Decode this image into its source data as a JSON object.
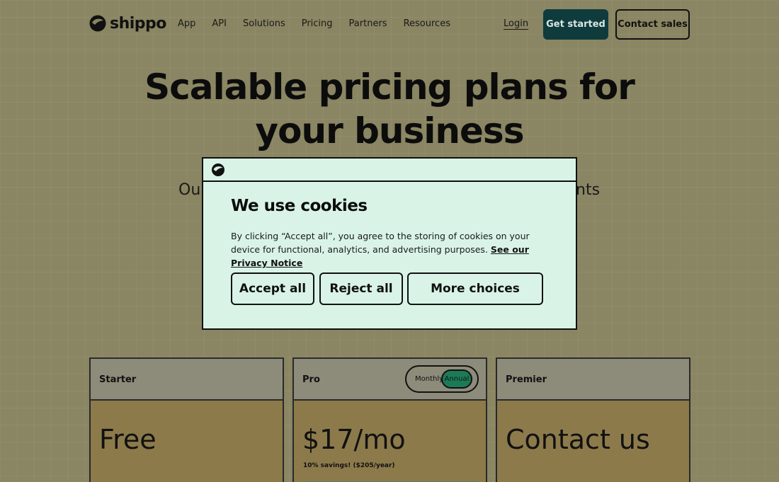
{
  "brand": {
    "name": "shippo",
    "logo_icon": "shippo-penguin-icon"
  },
  "nav": {
    "items": [
      "App",
      "API",
      "Solutions",
      "Pricing",
      "Partners",
      "Resources"
    ]
  },
  "header": {
    "login": "Login",
    "get_started": "Get started",
    "contact_sales": "Contact sales"
  },
  "hero": {
    "title": "Scalable pricing plans for your business",
    "subtitle_left": "Ou",
    "subtitle_right": "nts"
  },
  "cookie": {
    "title": "We use cookies",
    "text": "By clicking “Accept all”, you agree to the storing of cookies on your device for functional, analytics, and advertising purposes.",
    "link": "See our Privacy Notice",
    "accept": "Accept all",
    "reject": "Reject all",
    "more": "More choices"
  },
  "plans": [
    {
      "name": "Starter",
      "price": "Free"
    },
    {
      "name": "Pro",
      "price": "$17/mo",
      "note": "10% savings! ($205/year)",
      "toggle": {
        "monthly": "Monthly",
        "annual": "Annual",
        "selected": "Annual"
      }
    },
    {
      "name": "Premier",
      "price": "Contact us"
    }
  ],
  "colors": {
    "accent_dark": "#0f3b3d",
    "dialog_bg": "#d9f4e7",
    "toggle_active": "#1d7a57"
  }
}
